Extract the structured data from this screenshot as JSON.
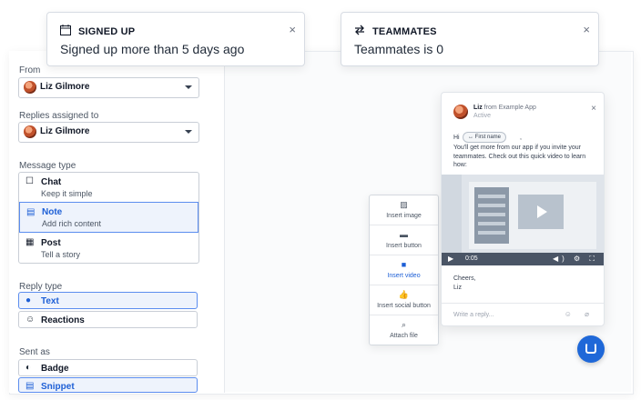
{
  "toasts": [
    {
      "title": "SIGNED UP",
      "body": "Signed up more than 5 days ago",
      "close": "×"
    },
    {
      "title": "TEAMMATES",
      "body": "Teammates is 0",
      "close": "×"
    }
  ],
  "form": {
    "from_label": "From",
    "from_value": "Liz Gilmore",
    "replies_label": "Replies assigned to",
    "replies_value": "Liz Gilmore",
    "message_type_label": "Message type",
    "message_types": [
      {
        "title": "Chat",
        "subtitle": "Keep it simple",
        "icon": "☐"
      },
      {
        "title": "Note",
        "subtitle": "Add rich content",
        "icon": "▤"
      },
      {
        "title": "Post",
        "subtitle": "Tell a story",
        "icon": "▦"
      }
    ],
    "reply_type_label": "Reply type",
    "reply_types": [
      {
        "title": "Text",
        "icon": "●"
      },
      {
        "title": "Reactions",
        "icon": "☺"
      }
    ],
    "sent_as_label": "Sent as",
    "sent_as": [
      {
        "title": "Badge",
        "icon": "◐"
      },
      {
        "title": "Snippet",
        "icon": "▤"
      }
    ]
  },
  "message": {
    "sender": "Liz",
    "from_app": "from Example App",
    "status": "Active",
    "close": "×",
    "greeting": "Hi",
    "chip": "↔  First name",
    "comma": ",",
    "text": "You'll get more from our app if you invite your teammates. Check out this quick video to learn how:",
    "video_time": "0:05",
    "video_play": "▶",
    "video_controls": "◀) ⚙ ⛶",
    "signoff": "Cheers,",
    "signname": "Liz",
    "reply_placeholder": "Write a reply...",
    "reply_icons": "☺ ⌀"
  },
  "tools": [
    {
      "label": "Insert image",
      "icon": "▨"
    },
    {
      "label": "Insert button",
      "icon": "▬"
    },
    {
      "label": "Insert video",
      "icon": "■"
    },
    {
      "label": "Insert social button",
      "icon": "👍"
    },
    {
      "label": "Attach file",
      "icon": "⌕"
    }
  ],
  "colors": {
    "accent": "#1d5fd6",
    "selected_bg": "#eef3fc",
    "launcher": "#1f68d8"
  }
}
